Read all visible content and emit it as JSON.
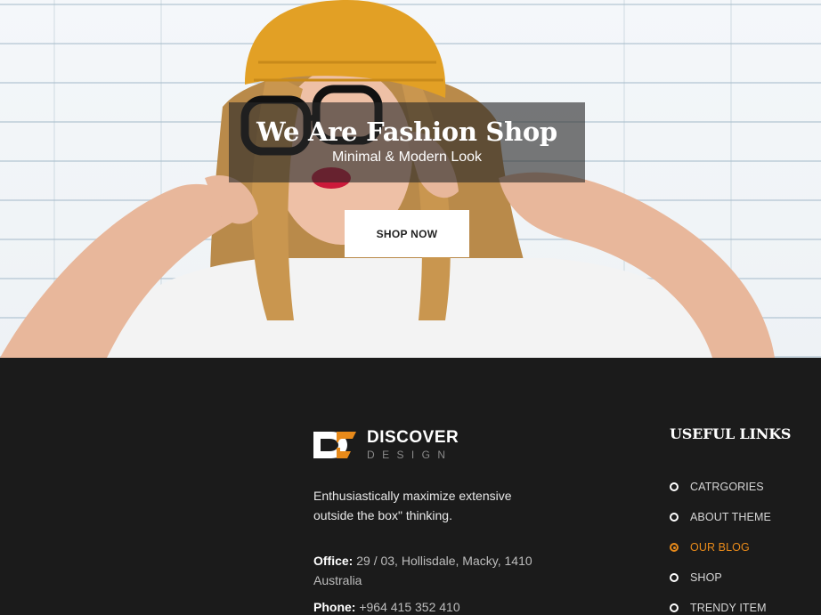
{
  "hero": {
    "title": "We Are Fashion Shop",
    "subtitle": "Minimal & Modern Look",
    "button_label": "SHOP NOW"
  },
  "footer": {
    "logo": {
      "name": "DISCOVER",
      "tagline": "DESIGN"
    },
    "about_text": "Enthusiastically maximize extensive outside the box\" thinking.",
    "office_label": "Office:",
    "office_value": "29 / 03, Hollisdale, Macky, 1410 Australia",
    "phone_label": "Phone:",
    "phone_value": "+964 415 352 410",
    "useful_links_title": "USEFUL LINKS",
    "links": [
      {
        "label": "CATRGORIES",
        "active": false
      },
      {
        "label": "ABOUT THEME",
        "active": false
      },
      {
        "label": "OUR BLOG",
        "active": true
      },
      {
        "label": "SHOP",
        "active": false
      },
      {
        "label": "TRENDY ITEM",
        "active": false
      }
    ]
  },
  "colors": {
    "accent": "#e88a1a",
    "footer_bg": "#1b1b1b",
    "overlay": "#282828"
  }
}
